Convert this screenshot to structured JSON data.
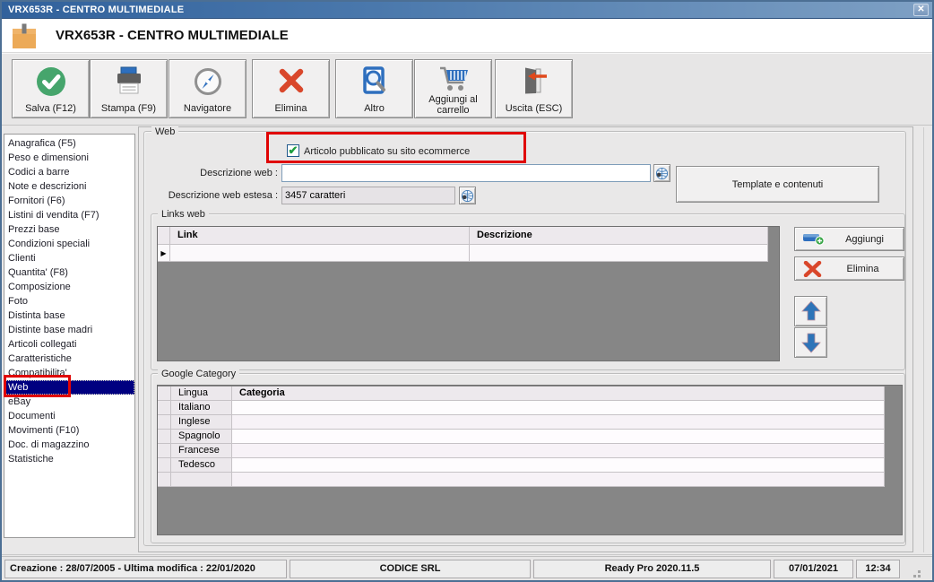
{
  "colors": {
    "annotation_red": "#E00404",
    "selection_navy": "#000080",
    "titlebar_blue": "#31619C",
    "accent_blue": "#2E6FBE",
    "delete_red": "#D9472B",
    "save_green": "#46A56C"
  },
  "titlebar": {
    "title": "VRX653R - CENTRO MULTIMEDIALE",
    "close_glyph": "✕"
  },
  "header": {
    "title": "VRX653R - CENTRO MULTIMEDIALE"
  },
  "toolbar": {
    "buttons": [
      {
        "label": "Salva (F12)",
        "icon": "save-check-circle"
      },
      {
        "label": "Stampa (F9)",
        "icon": "printer"
      },
      {
        "label": "Navigatore",
        "icon": "compass"
      },
      {
        "label": "Elimina",
        "icon": "red-x"
      },
      {
        "label": "Altro",
        "icon": "book-magnifier"
      },
      {
        "label": "Aggiungi al carrello",
        "icon": "shopping-cart"
      },
      {
        "label": "Uscita (ESC)",
        "icon": "exit-door"
      }
    ]
  },
  "sidebar": {
    "selected_item": "Web",
    "items": [
      "Anagrafica (F5)",
      "Peso e dimensioni",
      "Codici a barre",
      "Note e descrizioni",
      "Fornitori (F6)",
      "Listini di vendita (F7)",
      "Prezzi base",
      "Condizioni speciali",
      "Clienti",
      "Quantita' (F8)",
      "Composizione",
      "Foto",
      "Distinta base",
      "Distinte base madri",
      "Articoli collegati",
      "Caratteristiche",
      "Compatibilita'",
      "Web",
      "eBay",
      "Documenti",
      "Movimenti (F10)",
      "Doc. di magazzino",
      "Statistiche"
    ]
  },
  "web": {
    "group_label": "Web",
    "published_checkbox": {
      "label": "Articolo pubblicato su sito ecommerce",
      "checked": true,
      "check_glyph": "✔"
    },
    "descrizione_web": {
      "label": "Descrizione web :",
      "value": ""
    },
    "descrizione_web_estesa": {
      "label": "Descrizione web estesa :",
      "value": "3457 caratteri"
    },
    "template_button_label": "Template e contenuti",
    "links_web": {
      "group_label": "Links web",
      "columns": [
        "Link",
        "Descrizione"
      ],
      "rows": [
        {
          "link": "",
          "descrizione": ""
        }
      ],
      "row_selector_glyph": "▶",
      "aggiungi_label": "Aggiungi",
      "elimina_label": "Elimina"
    },
    "google_category": {
      "group_label": "Google Category",
      "columns": [
        "Lingua",
        "Categoria"
      ],
      "rows": [
        {
          "lingua": "Italiano",
          "categoria": ""
        },
        {
          "lingua": "Inglese",
          "categoria": ""
        },
        {
          "lingua": "Spagnolo",
          "categoria": ""
        },
        {
          "lingua": "Francese",
          "categoria": ""
        },
        {
          "lingua": "Tedesco",
          "categoria": ""
        },
        {
          "lingua": "",
          "categoria": ""
        }
      ]
    }
  },
  "statusbar": {
    "panels": [
      "Creazione : 28/07/2005 - Ultima modifica : 22/01/2020",
      "CODICE SRL",
      "Ready Pro 2020.11.5",
      "07/01/2021",
      "12:34"
    ]
  }
}
